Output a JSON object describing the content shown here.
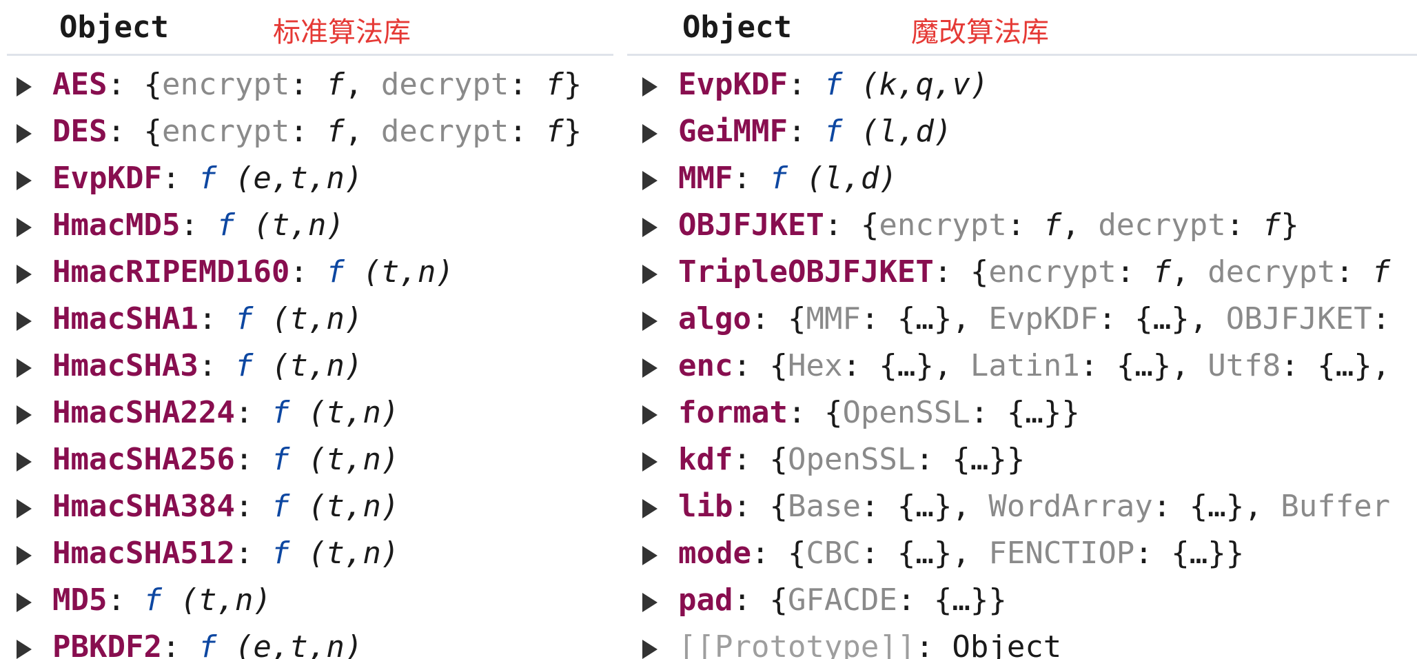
{
  "left": {
    "title": "Object",
    "tag": "标准算法库",
    "rows": [
      {
        "key": "AES",
        "sep": ":",
        "kind": "obj",
        "value": "{encrypt: f, decrypt: f}",
        "segments": [
          [
            "{",
            "pv"
          ],
          [
            "encrypt",
            "pk"
          ],
          [
            ": ",
            "pv"
          ],
          [
            "f",
            "fnplain"
          ],
          [
            ", ",
            "pv"
          ],
          [
            "decrypt",
            "pk"
          ],
          [
            ": ",
            "pv"
          ],
          [
            "f",
            "fnplain"
          ],
          [
            "}",
            "pv"
          ]
        ]
      },
      {
        "key": "DES",
        "sep": ":",
        "kind": "obj",
        "value": "{encrypt: f, decrypt: f}",
        "segments": [
          [
            "{",
            "pv"
          ],
          [
            "encrypt",
            "pk"
          ],
          [
            ": ",
            "pv"
          ],
          [
            "f",
            "fnplain"
          ],
          [
            ", ",
            "pv"
          ],
          [
            "decrypt",
            "pk"
          ],
          [
            ": ",
            "pv"
          ],
          [
            "f",
            "fnplain"
          ],
          [
            "}",
            "pv"
          ]
        ]
      },
      {
        "key": "EvpKDF",
        "sep": ":",
        "kind": "fn",
        "value": "f (e,t,n)",
        "f": "f",
        "args": "(e,t,n)"
      },
      {
        "key": "HmacMD5",
        "sep": ":",
        "kind": "fn",
        "value": "f (t,n)",
        "f": "f",
        "args": "(t,n)"
      },
      {
        "key": "HmacRIPEMD160",
        "sep": ":",
        "kind": "fn",
        "value": "f (t,n)",
        "f": "f",
        "args": "(t,n)"
      },
      {
        "key": "HmacSHA1",
        "sep": ":",
        "kind": "fn",
        "value": "f (t,n)",
        "f": "f",
        "args": "(t,n)"
      },
      {
        "key": "HmacSHA3",
        "sep": ":",
        "kind": "fn",
        "value": "f (t,n)",
        "f": "f",
        "args": "(t,n)"
      },
      {
        "key": "HmacSHA224",
        "sep": ":",
        "kind": "fn",
        "value": "f (t,n)",
        "f": "f",
        "args": "(t,n)"
      },
      {
        "key": "HmacSHA256",
        "sep": ":",
        "kind": "fn",
        "value": "f (t,n)",
        "f": "f",
        "args": "(t,n)"
      },
      {
        "key": "HmacSHA384",
        "sep": ":",
        "kind": "fn",
        "value": "f (t,n)",
        "f": "f",
        "args": "(t,n)"
      },
      {
        "key": "HmacSHA512",
        "sep": ":",
        "kind": "fn",
        "value": "f (t,n)",
        "f": "f",
        "args": "(t,n)"
      },
      {
        "key": "MD5",
        "sep": ":",
        "kind": "fn",
        "value": "f (t,n)",
        "f": "f",
        "args": "(t,n)"
      },
      {
        "key": "PBKDF2",
        "sep": ":",
        "kind": "fn",
        "value": "f (e,t,n)",
        "f": "f",
        "args": "(e,t,n)"
      }
    ]
  },
  "right": {
    "title": "Object",
    "tag": "魔改算法库",
    "rows": [
      {
        "key": "EvpKDF",
        "sep": ":",
        "kind": "fn",
        "value": "f (k,q,v)",
        "f": "f",
        "args": "(k,q,v)"
      },
      {
        "key": "GeiMMF",
        "sep": ":",
        "kind": "fn",
        "value": "f (l,d)",
        "f": "f",
        "args": "(l,d)"
      },
      {
        "key": "MMF",
        "sep": ":",
        "kind": "fn",
        "value": "f (l,d)",
        "f": "f",
        "args": "(l,d)"
      },
      {
        "key": "OBJFJKET",
        "sep": ":",
        "kind": "obj",
        "value": "{encrypt: f, decrypt: f}",
        "segments": [
          [
            "{",
            "pv"
          ],
          [
            "encrypt",
            "pk"
          ],
          [
            ": ",
            "pv"
          ],
          [
            "f",
            "fnplain"
          ],
          [
            ", ",
            "pv"
          ],
          [
            "decrypt",
            "pk"
          ],
          [
            ": ",
            "pv"
          ],
          [
            "f",
            "fnplain"
          ],
          [
            "}",
            "pv"
          ]
        ]
      },
      {
        "key": "TripleOBJFJKET",
        "sep": ":",
        "kind": "obj",
        "value": "{encrypt: f, decrypt: f",
        "segments": [
          [
            "{",
            "pv"
          ],
          [
            "encrypt",
            "pk"
          ],
          [
            ": ",
            "pv"
          ],
          [
            "f",
            "fnplain"
          ],
          [
            ", ",
            "pv"
          ],
          [
            "decrypt",
            "pk"
          ],
          [
            ": ",
            "pv"
          ],
          [
            "f",
            "fnplain"
          ]
        ]
      },
      {
        "key": "algo",
        "sep": ":",
        "kind": "obj",
        "value": "{MMF: {…}, EvpKDF: {…}, OBJFJKET:",
        "segments": [
          [
            "{",
            "pv"
          ],
          [
            "MMF",
            "pk"
          ],
          [
            ": {…}, ",
            "pv"
          ],
          [
            "EvpKDF",
            "pk"
          ],
          [
            ": {…}, ",
            "pv"
          ],
          [
            "OBJFJKET",
            "pk"
          ],
          [
            ":",
            "pv"
          ]
        ]
      },
      {
        "key": "enc",
        "sep": ":",
        "kind": "obj",
        "value": "{Hex: {…}, Latin1: {…}, Utf8: {…},",
        "segments": [
          [
            "{",
            "pv"
          ],
          [
            "Hex",
            "pk"
          ],
          [
            ": {…}, ",
            "pv"
          ],
          [
            "Latin1",
            "pk"
          ],
          [
            ": {…}, ",
            "pv"
          ],
          [
            "Utf8",
            "pk"
          ],
          [
            ": {…},",
            "pv"
          ]
        ]
      },
      {
        "key": "format",
        "sep": ":",
        "kind": "obj",
        "value": "{OpenSSL: {…}}",
        "segments": [
          [
            "{",
            "pv"
          ],
          [
            "OpenSSL",
            "pk"
          ],
          [
            ": {…}}",
            "pv"
          ]
        ]
      },
      {
        "key": "kdf",
        "sep": ":",
        "kind": "obj",
        "value": "{OpenSSL: {…}}",
        "segments": [
          [
            "{",
            "pv"
          ],
          [
            "OpenSSL",
            "pk"
          ],
          [
            ": {…}}",
            "pv"
          ]
        ]
      },
      {
        "key": "lib",
        "sep": ":",
        "kind": "obj",
        "value": "{Base: {…}, WordArray: {…}, Buffer",
        "segments": [
          [
            "{",
            "pv"
          ],
          [
            "Base",
            "pk"
          ],
          [
            ": {…}, ",
            "pv"
          ],
          [
            "WordArray",
            "pk"
          ],
          [
            ": {…}, ",
            "pv"
          ],
          [
            "Buffer",
            "pk"
          ]
        ]
      },
      {
        "key": "mode",
        "sep": ":",
        "kind": "obj",
        "value": "{CBC: {…}, FENCTIOP: {…}}",
        "segments": [
          [
            "{",
            "pv"
          ],
          [
            "CBC",
            "pk"
          ],
          [
            ": {…}, ",
            "pv"
          ],
          [
            "FENCTIOP",
            "pk"
          ],
          [
            ": {…}}",
            "pv"
          ]
        ]
      },
      {
        "key": "pad",
        "sep": ":",
        "kind": "obj",
        "value": "{GFACDE: {…}}",
        "segments": [
          [
            "{",
            "pv"
          ],
          [
            "GFACDE",
            "pk"
          ],
          [
            ": {…}}",
            "pv"
          ]
        ]
      },
      {
        "key": "[[Prototype]]",
        "sep": ":",
        "kind": "proto",
        "value": "Object"
      }
    ]
  },
  "icons": {
    "expand": "expand-triangle-icon"
  },
  "colors": {
    "key": "#880e4f",
    "fn": "#0d47a1",
    "preview": "#8a8a8a",
    "tag": "#e53935"
  }
}
